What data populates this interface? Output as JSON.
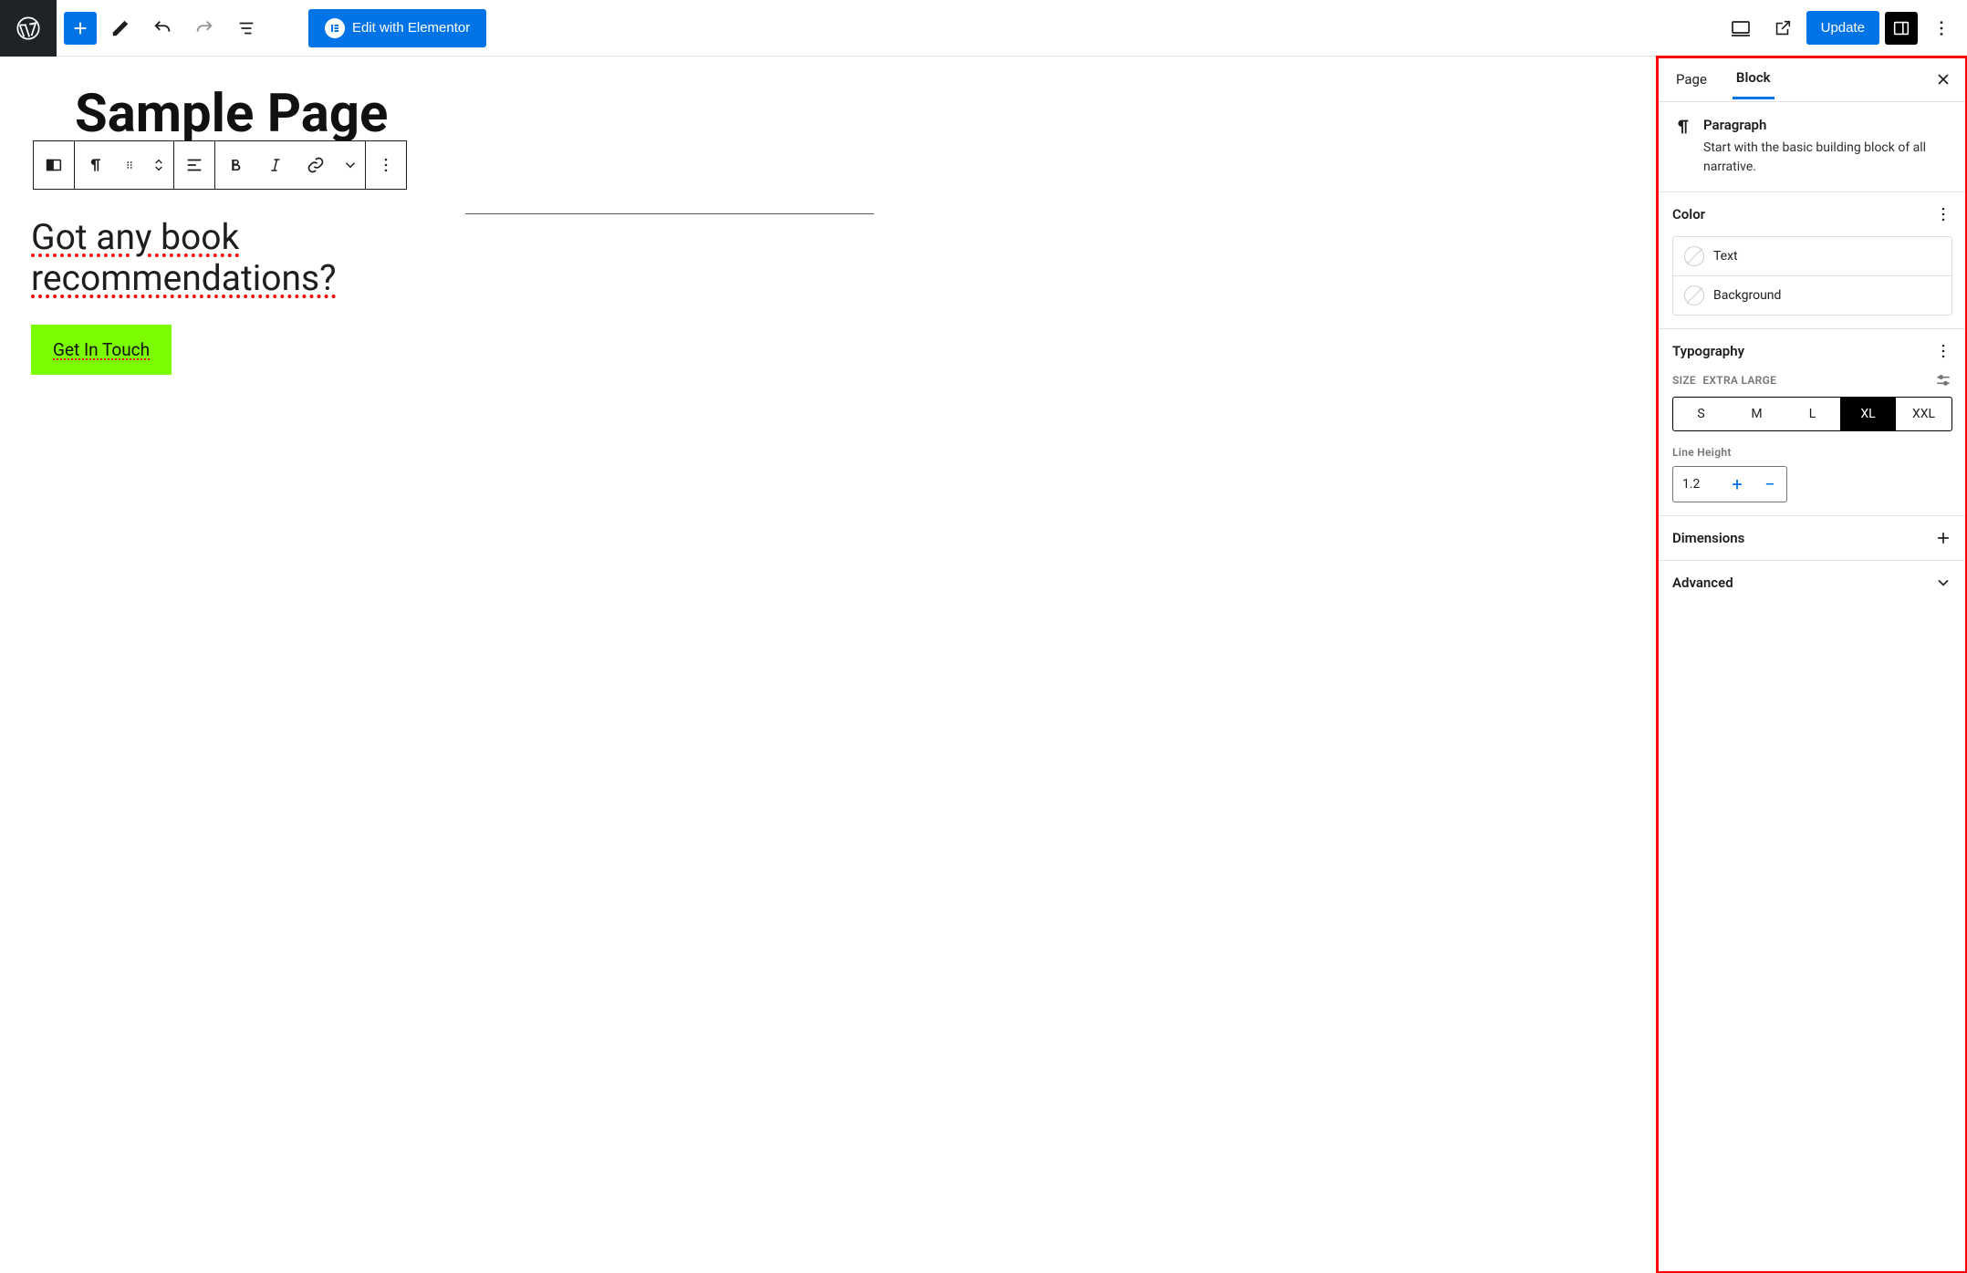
{
  "top": {
    "elementor_label": "Edit with Elementor",
    "update_label": "Update"
  },
  "canvas": {
    "page_title": "Sample Page",
    "paragraph_text": "Got any book recommendations?",
    "cta_label": "Get In Touch"
  },
  "sidebar": {
    "tabs": {
      "page": "Page",
      "block": "Block"
    },
    "block_info": {
      "name": "Paragraph",
      "description": "Start with the basic building block of all narrative."
    },
    "color": {
      "title": "Color",
      "text_label": "Text",
      "background_label": "Background"
    },
    "typography": {
      "title": "Typography",
      "size_label": "Size",
      "size_value": "Extra Large",
      "sizes": [
        "S",
        "M",
        "L",
        "XL",
        "XXL"
      ],
      "active_size": "XL",
      "line_height_label": "Line Height",
      "line_height_value": "1.2"
    },
    "dimensions_title": "Dimensions",
    "advanced_title": "Advanced"
  }
}
